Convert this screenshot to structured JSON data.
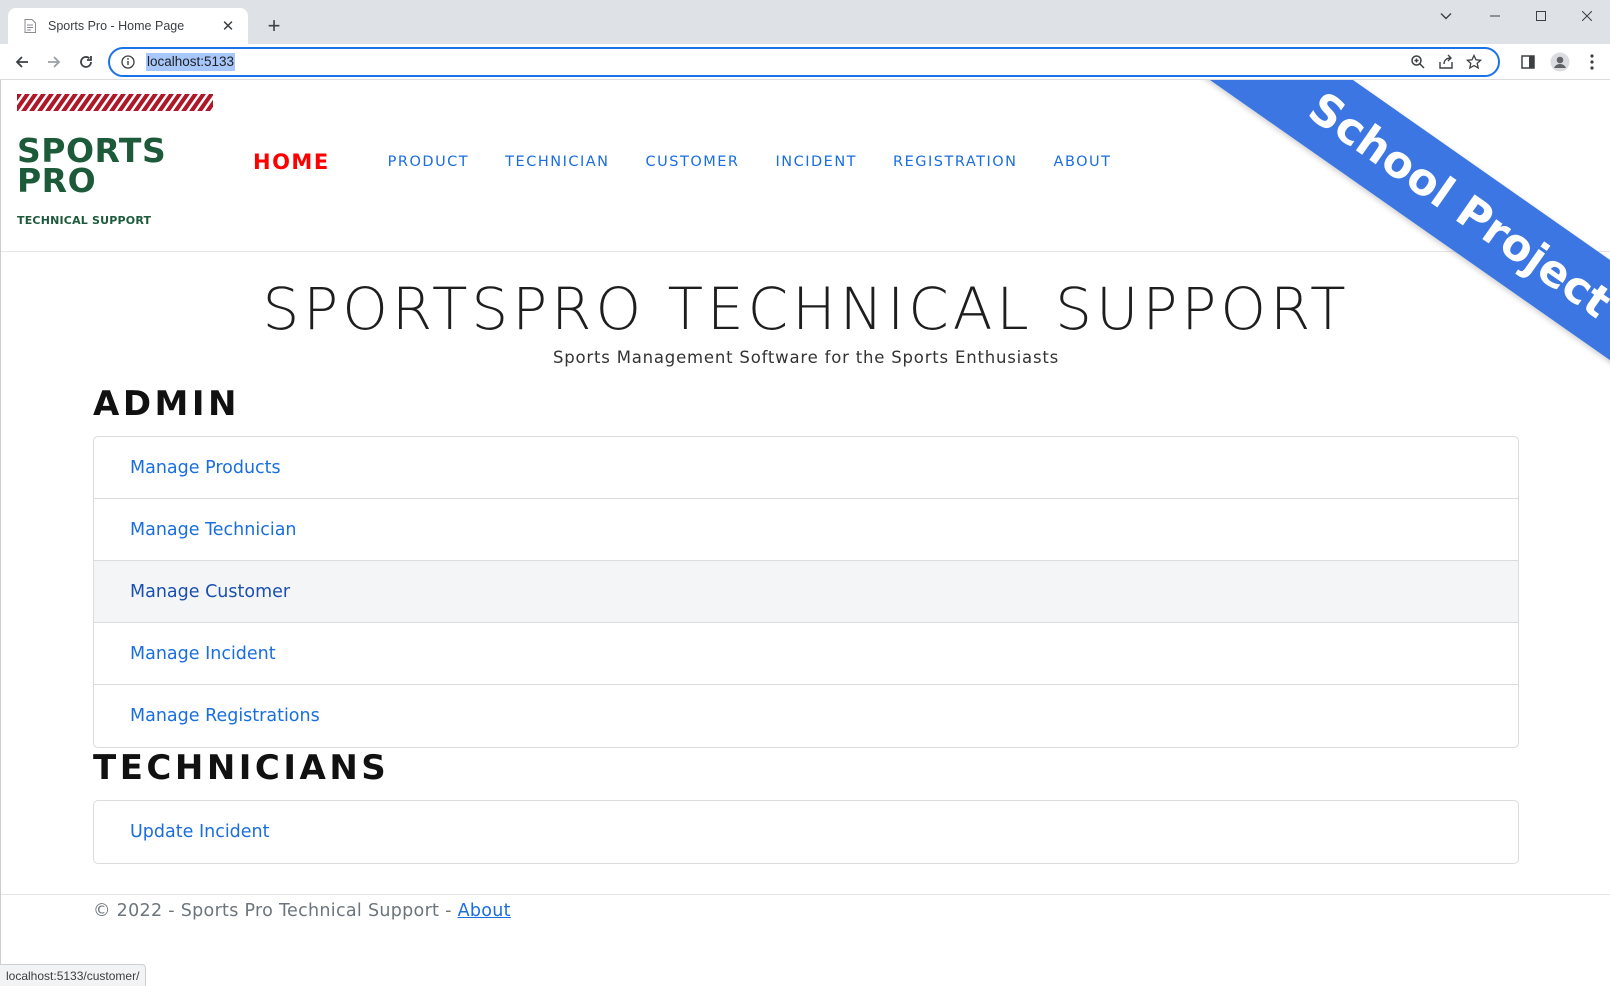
{
  "browser": {
    "tab_title": "Sports Pro - Home Page",
    "url": "localhost:5133",
    "status_url": "localhost:5133/customer/"
  },
  "logo": {
    "line1": "SPORTS",
    "line2": "PRO",
    "subtitle": "TECHNICAL SUPPORT"
  },
  "nav": {
    "home": "HOME",
    "links": [
      "PRODUCT",
      "TECHNICIAN",
      "CUSTOMER",
      "INCIDENT",
      "REGISTRATION",
      "ABOUT"
    ]
  },
  "ribbon": "School Project",
  "hero": {
    "title": "SPORTSPRO TECHNICAL SUPPORT",
    "subtitle": "Sports Management Software for the Sports Enthusiasts"
  },
  "admin": {
    "heading": "ADMIN",
    "items": [
      "Manage Products",
      "Manage Technician",
      "Manage Customer",
      "Manage Incident",
      "Manage Registrations"
    ]
  },
  "technicians": {
    "heading": "TECHNICIANS",
    "items": [
      "Update Incident"
    ]
  },
  "footer": {
    "text": "© 2022 - Sports Pro Technical Support - ",
    "link": "About"
  },
  "colors": {
    "brand_green": "#1c5a3a",
    "nav_link": "#1a6ee0",
    "home_red": "#ff0000",
    "ribbon_blue": "#3b76e3"
  }
}
